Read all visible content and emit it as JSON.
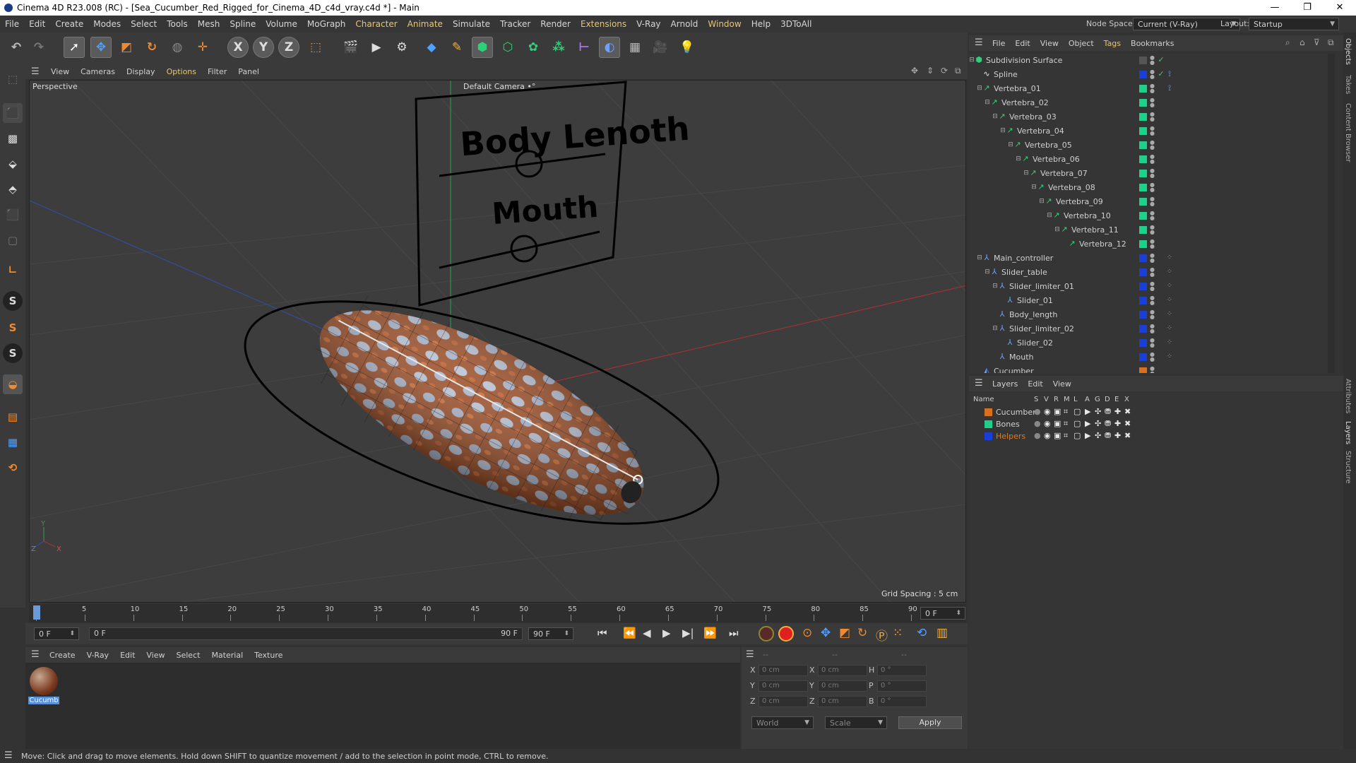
{
  "window": {
    "title": "Cinema 4D R23.008 (RC) - [Sea_Cucumber_Red_Rigged_for_Cinema_4D_c4d_vray.c4d *] - Main",
    "minimize": "—",
    "maximize": "❐",
    "close": "✕"
  },
  "menubar": {
    "items": [
      "File",
      "Edit",
      "Create",
      "Modes",
      "Select",
      "Tools",
      "Mesh",
      "Spline",
      "Volume",
      "MoGraph",
      "Character",
      "Animate",
      "Simulate",
      "Tracker",
      "Render",
      "Extensions",
      "V-Ray",
      "Arnold",
      "Window",
      "Help",
      "3DToAll"
    ],
    "node_space_label": "Node Space:",
    "node_space_value": "Current (V-Ray)",
    "layout_label": "Layout:",
    "layout_value": "Startup"
  },
  "viewport": {
    "menu": [
      "View",
      "Cameras",
      "Display",
      "Options",
      "Filter",
      "Panel"
    ],
    "view_name": "Perspective",
    "camera": "Default Camera",
    "camera_marker": "•°",
    "grid_spacing": "Grid Spacing : 5 cm",
    "sign_title": "Body Lenoth",
    "sign_subtitle": "Mouth",
    "axis_y": "Y",
    "axis_z": "Z",
    "axis_x": "X"
  },
  "timeline": {
    "ticks": [
      "0",
      "5",
      "10",
      "15",
      "20",
      "25",
      "30",
      "35",
      "40",
      "45",
      "50",
      "55",
      "60",
      "65",
      "70",
      "75",
      "80",
      "85",
      "90"
    ],
    "current_frame_right": "0 F",
    "start_field": "0 F",
    "range_start": "0 F",
    "range_end": "90 F",
    "end_field": "90 F"
  },
  "material_manager": {
    "menu": [
      "Create",
      "V-Ray",
      "Edit",
      "View",
      "Select",
      "Material",
      "Texture"
    ],
    "material_name": "Cucumb"
  },
  "coordinates": {
    "header_dash_1": "--",
    "header_dash_2": "--",
    "header_dash_3": "--",
    "rows": [
      {
        "l1": "X",
        "v1": "0 cm",
        "l2": "X",
        "v2": "0 cm",
        "l3": "H",
        "v3": "0 °"
      },
      {
        "l1": "Y",
        "v1": "0 cm",
        "l2": "Y",
        "v2": "0 cm",
        "l3": "P",
        "v3": "0 °"
      },
      {
        "l1": "Z",
        "v1": "0 cm",
        "l2": "Z",
        "v2": "0 cm",
        "l3": "B",
        "v3": "0 °"
      }
    ],
    "space": "World",
    "mode": "Scale",
    "apply": "Apply"
  },
  "status": {
    "text": "Move: Click and drag to move elements. Hold down SHIFT to quantize movement / add to the selection in point mode, CTRL to remove."
  },
  "object_manager": {
    "menu": [
      "File",
      "Edit",
      "View",
      "Object",
      "Tags",
      "Bookmarks"
    ],
    "objects": [
      {
        "name": "Subdivision Surface",
        "indent": 0,
        "layer": "#555555",
        "type": "subd"
      },
      {
        "name": "Spline",
        "indent": 1,
        "layer": "#1a3fd6",
        "type": "spline"
      },
      {
        "name": "Vertebra_01",
        "indent": 1,
        "layer": "#1fd08a",
        "type": "bone"
      },
      {
        "name": "Vertebra_02",
        "indent": 2,
        "layer": "#1fd08a",
        "type": "bone"
      },
      {
        "name": "Vertebra_03",
        "indent": 3,
        "layer": "#1fd08a",
        "type": "bone"
      },
      {
        "name": "Vertebra_04",
        "indent": 4,
        "layer": "#1fd08a",
        "type": "bone"
      },
      {
        "name": "Vertebra_05",
        "indent": 5,
        "layer": "#1fd08a",
        "type": "bone"
      },
      {
        "name": "Vertebra_06",
        "indent": 6,
        "layer": "#1fd08a",
        "type": "bone"
      },
      {
        "name": "Vertebra_07",
        "indent": 7,
        "layer": "#1fd08a",
        "type": "bone"
      },
      {
        "name": "Vertebra_08",
        "indent": 8,
        "layer": "#1fd08a",
        "type": "bone"
      },
      {
        "name": "Vertebra_09",
        "indent": 9,
        "layer": "#1fd08a",
        "type": "bone"
      },
      {
        "name": "Vertebra_10",
        "indent": 10,
        "layer": "#1fd08a",
        "type": "bone"
      },
      {
        "name": "Vertebra_11",
        "indent": 11,
        "layer": "#1fd08a",
        "type": "bone"
      },
      {
        "name": "Vertebra_12",
        "indent": 12,
        "layer": "#1fd08a",
        "type": "bone"
      },
      {
        "name": "Main_controller",
        "indent": 1,
        "layer": "#1a3fd6",
        "type": "null"
      },
      {
        "name": "Slider_table",
        "indent": 2,
        "layer": "#1a3fd6",
        "type": "null"
      },
      {
        "name": "Slider_limiter_01",
        "indent": 3,
        "layer": "#1a3fd6",
        "type": "null"
      },
      {
        "name": "Slider_01",
        "indent": 4,
        "layer": "#1a3fd6",
        "type": "null"
      },
      {
        "name": "Body_length",
        "indent": 3,
        "layer": "#1a3fd6",
        "type": "null"
      },
      {
        "name": "Slider_limiter_02",
        "indent": 3,
        "layer": "#1a3fd6",
        "type": "null"
      },
      {
        "name": "Slider_02",
        "indent": 4,
        "layer": "#1a3fd6",
        "type": "null"
      },
      {
        "name": "Mouth",
        "indent": 3,
        "layer": "#1a3fd6",
        "type": "null"
      },
      {
        "name": "Cucumber",
        "indent": 1,
        "layer": "#d8701f",
        "type": "poly"
      }
    ]
  },
  "layers": {
    "menu": [
      "Layers",
      "Edit",
      "View"
    ],
    "headers": [
      "Name",
      "S",
      "V",
      "R",
      "M",
      "L",
      "A",
      "G",
      "D",
      "E",
      "X"
    ],
    "rows": [
      {
        "name": "Cucumber",
        "color": "#d8701f",
        "text_color": "#d0d0d0"
      },
      {
        "name": "Bones",
        "color": "#1fd08a",
        "text_color": "#d0d0d0"
      },
      {
        "name": "Helpers",
        "color": "#1a3fd6",
        "text_color": "#e07a22"
      }
    ]
  },
  "right_tabs": [
    "Objects",
    "Takes",
    "Content Browser",
    "Attributes",
    "Layers",
    "Structure"
  ],
  "colors": {
    "accent_orange": "#e07a22",
    "selection_blue": "#5a8fd6"
  }
}
